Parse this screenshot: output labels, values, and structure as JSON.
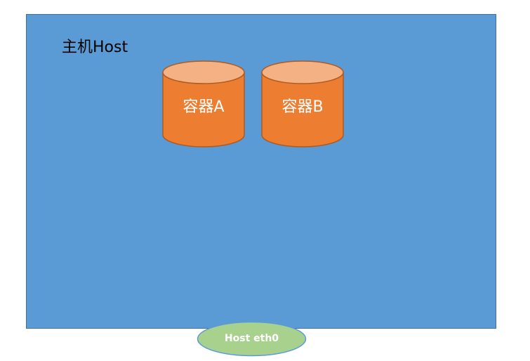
{
  "host": {
    "label": "主机Host"
  },
  "containers": [
    {
      "label": "容器A"
    },
    {
      "label": "容器B"
    }
  ],
  "nic": {
    "label": "Host eth0"
  },
  "colors": {
    "host_fill": "#5b9bd5",
    "host_border": "#41719c",
    "cylinder_body": "#ed7d31",
    "cylinder_top": "#f4b183",
    "cylinder_stroke": "#ae5a21",
    "nic_fill": "#a9d18e",
    "nic_stroke": "#5b9bd5"
  }
}
